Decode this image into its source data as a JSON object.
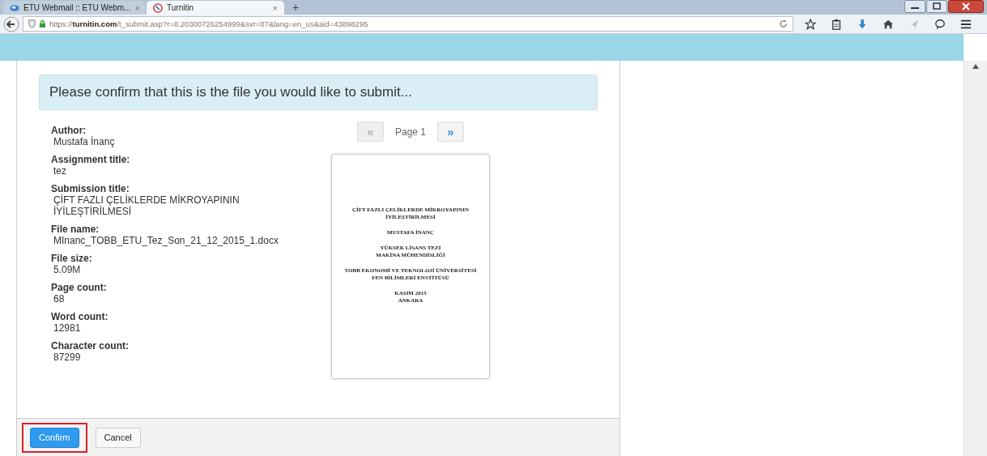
{
  "tabs": [
    {
      "title": "ETU Webmail :: ETU Webm...",
      "close": "×",
      "selected": false
    },
    {
      "title": "Turnitin",
      "close": "×",
      "selected": true
    }
  ],
  "new_tab": "+",
  "address": {
    "prefix": "https://",
    "host": "turnitin.com",
    "path": "/t_submit.asp?r=8.20300726254999&svr=07&lang=en_us&aid=43898295"
  },
  "heading": "Please confirm that this is the file you would like to submit...",
  "fields": [
    {
      "label": "Author:",
      "value": "Mustafa İnanç"
    },
    {
      "label": "Assignment title:",
      "value": "tez"
    },
    {
      "label": "Submission title:",
      "value": "ÇİFT FAZLI ÇELİKLERDE MİKROYAPININ İYİLEŞTİRİLMESİ"
    },
    {
      "label": "File name:",
      "value": "MInanc_TOBB_ETU_Tez_Son_21_12_2015_1.docx"
    },
    {
      "label": "File size:",
      "value": "5.09M"
    },
    {
      "label": "Page count:",
      "value": "68"
    },
    {
      "label": "Word count:",
      "value": "12981"
    },
    {
      "label": "Character count:",
      "value": "87299"
    }
  ],
  "pager": {
    "prev": "«",
    "label": "Page 1",
    "next": "»",
    "prev_disabled": true
  },
  "document_blocks": [
    {
      "lines": [
        "ÇİFT FAZLI ÇELİKLERDE MİKROYAPININ İYİLEŞTİRİLMESİ"
      ]
    },
    {
      "lines": [
        "MUSTAFA İNANÇ"
      ]
    },
    {
      "lines": [
        "YÜKSEK LİSANS TEZİ",
        "MAKİNA MÜHENDİSLİĞİ"
      ]
    },
    {
      "lines": [
        "TOBB EKONOMİ VE TEKNOLOJİ ÜNİVERSİTESİ",
        "FEN BİLİMLERİ ENSTİTÜSÜ"
      ]
    },
    {
      "lines": [
        "KASIM 2015",
        "ANKARA"
      ]
    }
  ],
  "buttons": [
    {
      "label": "Confirm",
      "kind": "primary",
      "highlighted": true
    },
    {
      "label": "Cancel",
      "kind": "default",
      "highlighted": false
    }
  ]
}
